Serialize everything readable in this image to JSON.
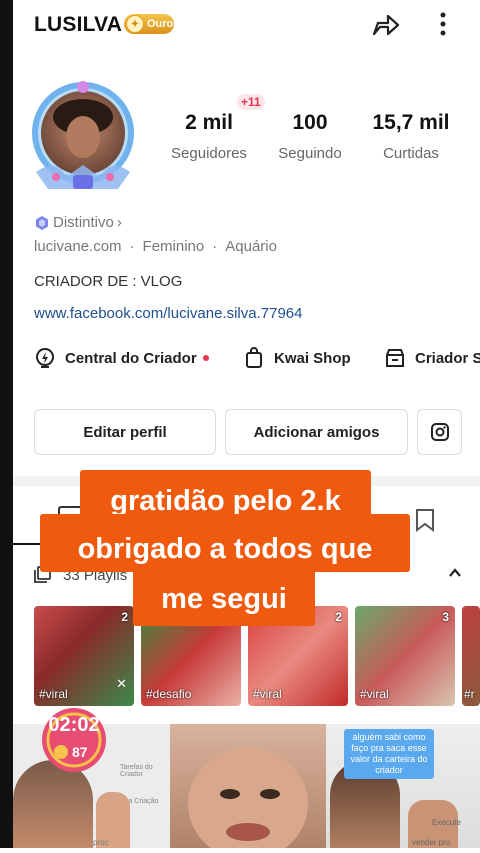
{
  "header": {
    "username": "LUSILVA",
    "badge_label": "Ouro"
  },
  "stats": {
    "new_followers": "+11",
    "items": [
      {
        "value": "2 mil",
        "label": "Seguidores"
      },
      {
        "value": "100",
        "label": "Seguindo"
      },
      {
        "value": "15,7 mil",
        "label": "Curtidas"
      }
    ]
  },
  "profile": {
    "distinctive": "Distintivo",
    "meta": [
      "lucivane.com",
      "Feminino",
      "Aquário"
    ],
    "bio": "CRIADOR DE : VLOG",
    "link": "www.facebook.com/lucivane.silva.77964"
  },
  "tools": [
    {
      "label": "Central do Criador",
      "icon": "creator-center-icon"
    },
    {
      "label": "Kwai Shop",
      "icon": "shopping-bag-icon"
    },
    {
      "label": "Criador S",
      "icon": "store-icon"
    }
  ],
  "buttons": {
    "edit": "Editar perfil",
    "add_friends": "Adicionar amigos"
  },
  "playlists": {
    "count_label": "33 Playlis"
  },
  "overlay_text": [
    "gratidão pelo 2.k",
    "obrigado a todos que",
    "me segui"
  ],
  "thumbnails": [
    {
      "tag": "#viral",
      "count": "2"
    },
    {
      "tag": "#desafio",
      "count": ""
    },
    {
      "tag": "#viral",
      "count": "2"
    },
    {
      "tag": "#viral",
      "count": "3"
    },
    {
      "tag": "#r",
      "count": ""
    }
  ],
  "timer": {
    "time": "02:02",
    "coins": "87"
  },
  "bg_labels": {
    "tarefas": "Tarefas do Criador",
    "nova": "Nova Criação",
    "executar": "Execute",
    "vender": "vender pro",
    "proc": "proc"
  },
  "caption": "alguém sabi como faço pra saca esse valor da carteira do criador",
  "colors": {
    "accent": "#f05a0f",
    "link": "#1f4f8f",
    "red_dot": "#e8334a"
  }
}
